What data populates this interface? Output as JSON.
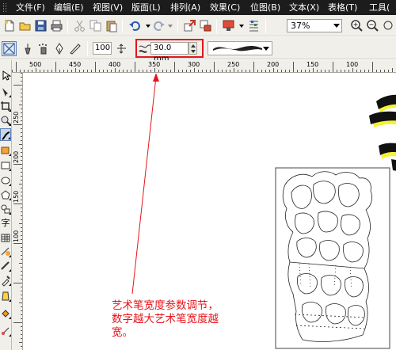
{
  "menu": [
    "文件(F)",
    "编辑(E)",
    "视图(V)",
    "版面(L)",
    "排列(A)",
    "效果(C)",
    "位图(B)",
    "文本(X)",
    "表格(T)",
    "工具("
  ],
  "toolbar": {
    "zoom_value": "37%"
  },
  "property_bar": {
    "smoothing_value": "100",
    "width_value": "30.0 mm"
  },
  "ruler_h_labels": [
    "500",
    "450",
    "400",
    "350",
    "300",
    "250",
    "200",
    "150",
    "100"
  ],
  "ruler_v_labels": [
    "250",
    "200",
    "150",
    "100"
  ],
  "toolbox_letter": "字",
  "annotation": {
    "line1": "艺术笔宽度参数调节，",
    "line2": "数字越大艺术笔宽度越",
    "line3": "宽。"
  },
  "colors": {
    "menubar": "#1c1c1c",
    "highlight": "#e8141b",
    "chrome": "#f0efea",
    "shape_glow": "#f7f233"
  }
}
